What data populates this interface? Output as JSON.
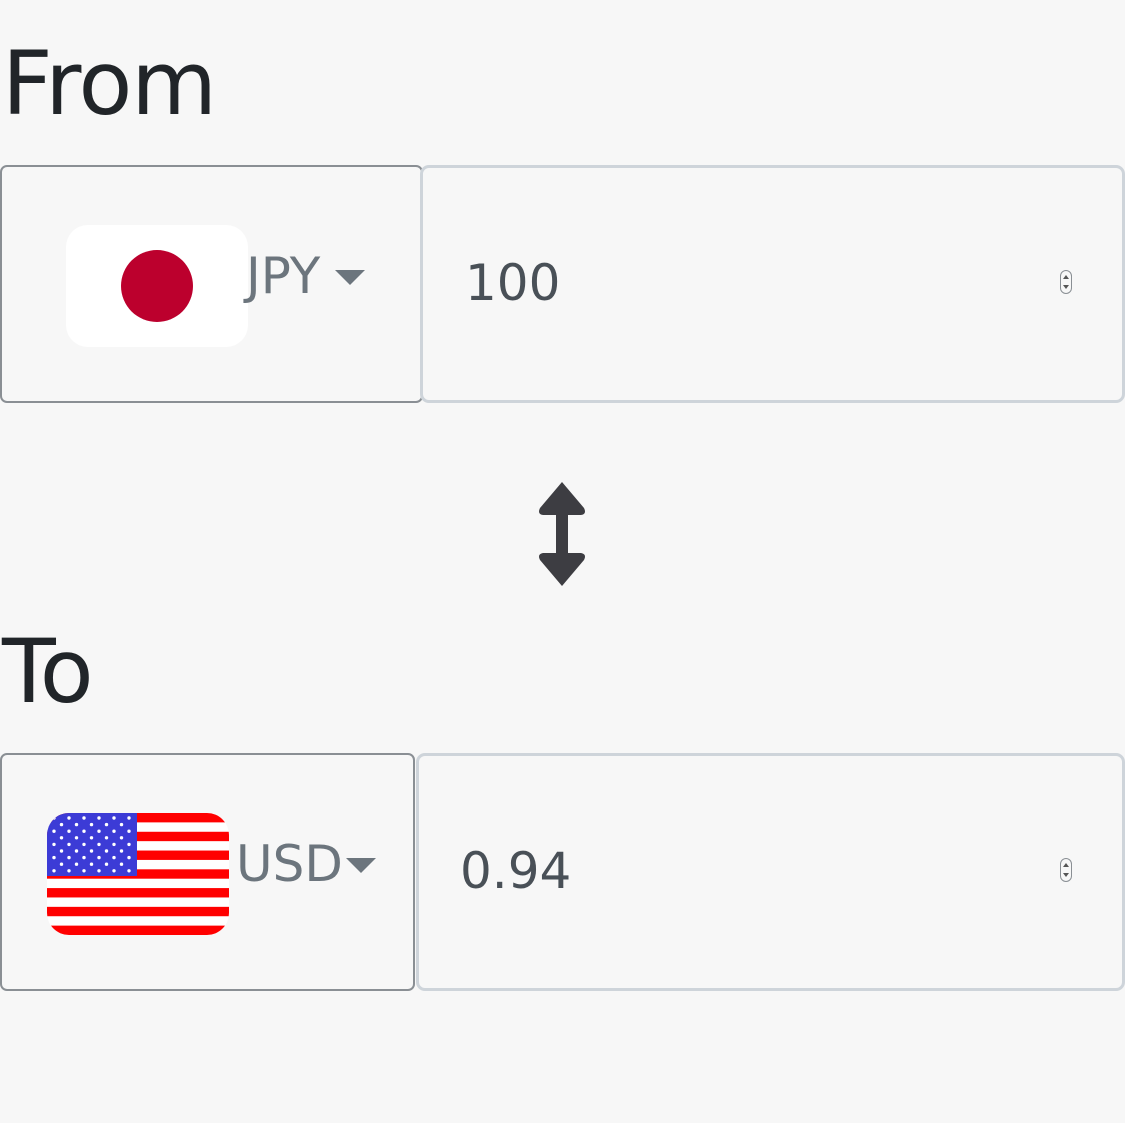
{
  "from": {
    "label": "From",
    "currency_code": "JPY",
    "flag": "japan-flag",
    "amount": "100"
  },
  "to": {
    "label": "To",
    "currency_code": "USD",
    "flag": "usa-flag",
    "amount": "0.94"
  },
  "swap": {
    "icon": "swap-vertical-arrows-icon"
  },
  "colors": {
    "background": "#f7f7f7",
    "japan_red": "#bc002d",
    "us_red": "#ff0000",
    "us_blue": "#3c3bd6",
    "icon_dark": "#3d3d42"
  }
}
